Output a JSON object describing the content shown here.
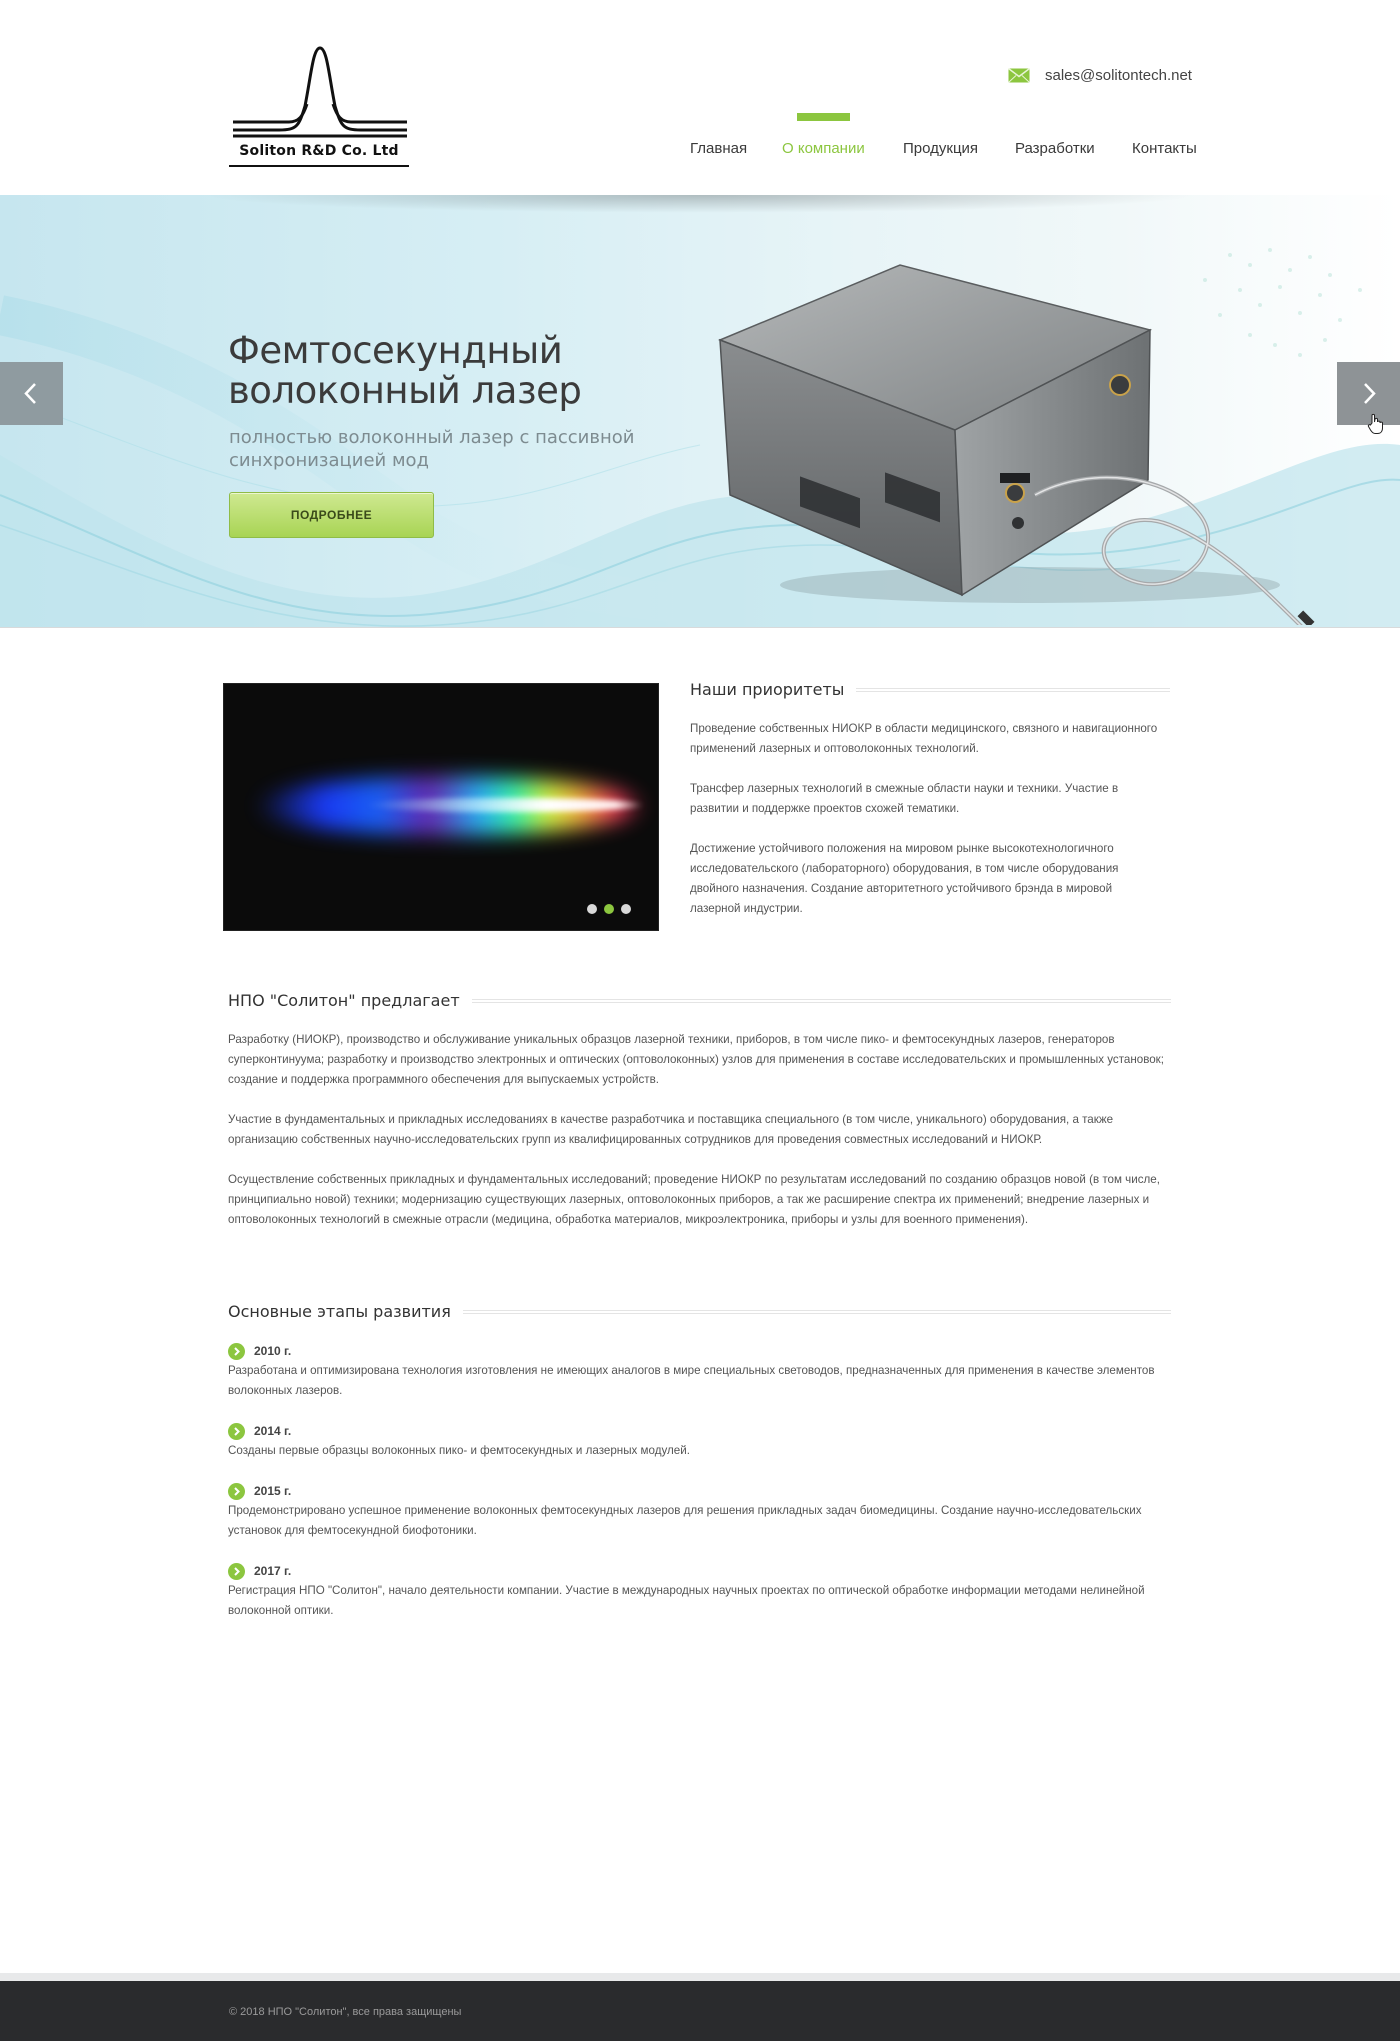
{
  "header": {
    "logo_text": "Soliton R&D Co. Ltd",
    "email": "sales@solitontech.net",
    "email_icon": "envelope-icon"
  },
  "nav": {
    "items": [
      {
        "label": "Главная",
        "active": false
      },
      {
        "label": "О компании",
        "active": true
      },
      {
        "label": "Продукция",
        "active": false
      },
      {
        "label": "Разработки",
        "active": false
      },
      {
        "label": "Контакты",
        "active": false
      }
    ],
    "accent_color": "#8cc63f"
  },
  "slider": {
    "title_line1": "Фемтосекундный",
    "title_line2": "волоконный лазер",
    "subtitle": "полностью волоконный лазер с пассивной синхронизацией мод",
    "button_label": "ПОДРОБНЕЕ",
    "prev_icon": "chevron-left-icon",
    "next_icon": "chevron-right-icon"
  },
  "gallery": {
    "dots": [
      false,
      true,
      false
    ]
  },
  "priorities": {
    "title": "Наши приоритеты",
    "paragraphs": [
      "Проведение собственных НИОКР в области медицинского, связного и навигационного применений лазерных и оптоволоконных технологий.",
      "Трансфер лазерных технологий в смежные области науки и техники. Участие в развитии и поддержке проектов схожей тематики.",
      "Достижение устойчивого положения на мировом рынке высокотехнологичного исследовательского (лабораторного) оборудования, в том числе оборудования двойного назначения. Создание авторитетного устойчивого брэнда в мировой лазерной индустрии."
    ]
  },
  "offers": {
    "title": "НПО \"Солитон\" предлагает",
    "paragraphs": [
      "Разработку (НИОКР), производство и обслуживание уникальных образцов лазерной техники, приборов, в том числе пико- и фемтосекундных лазеров, генераторов суперконтинуума; разработку и производство электронных и оптических (оптоволоконных) узлов для применения в составе исследовательских и промышленных установок; создание и поддержка программного обеспечения для выпускаемых устройств.",
      "Участие в фундаментальных и прикладных исследованиях в качестве разработчика и поставщика специального (в том числе, уникального) оборудования, а также организацию собственных научно-исследовательских групп из квалифицированных сотрудников для проведения совместных исследований и НИОКР.",
      "Осуществление собственных прикладных и фундаментальных исследований; проведение НИОКР по результатам исследований по созданию образцов новой (в том числе, принципиально новой) техники; модернизацию существующих лазерных, оптоволоконных приборов, а так же расширение спектра их применений; внедрение лазерных и оптоволоконных технологий в смежные отрасли (медицина, обработка материалов, микроэлектроника, приборы и узлы для военного применения)."
    ]
  },
  "milestones": {
    "title": "Основные этапы развития",
    "items": [
      {
        "year": "2010 г.",
        "text": "Разработана и оптимизирована технология изготовления не имеющих аналогов в мире специальных световодов, предназначенных для применения в качестве элементов волоконных лазеров."
      },
      {
        "year": "2014 г.",
        "text": "Созданы первые образцы волоконных пико- и фемтосекундных и лазерных модулей."
      },
      {
        "year": "2015 г.",
        "text": "Продемонстрировано успешное применение волоконных фемтосекундных лазеров для решения прикладных задач биомедицины. Создание научно-исследовательских установок для фемтосекундной биофотоники."
      },
      {
        "year": "2017 г.",
        "text": "Регистрация НПО \"Солитон\", начало деятельности компании. Участие в международных научных проектах по оптической обработке информации методами нелинейной волоконной оптики."
      }
    ]
  },
  "footer": {
    "copyright": "© 2018 НПО \"Солитон\", все права защищены"
  }
}
